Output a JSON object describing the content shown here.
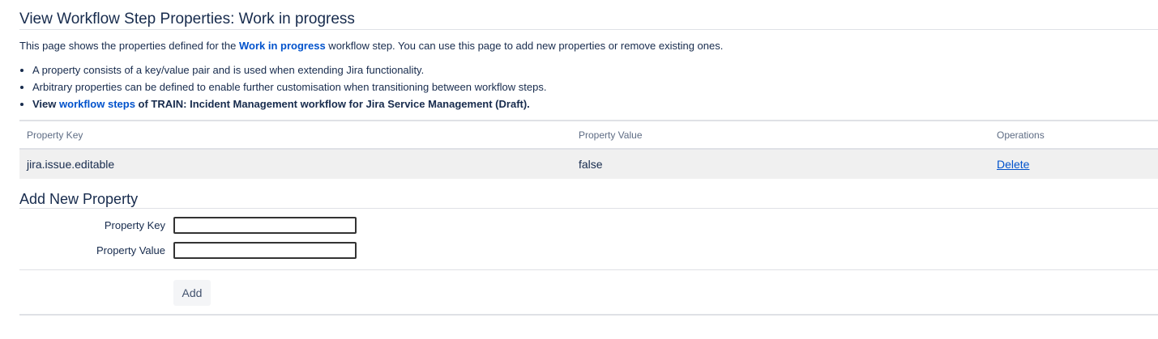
{
  "page": {
    "title": "View Workflow Step Properties: Work in progress",
    "intro_before": "This page shows the properties defined for the ",
    "intro_link": "Work in progress",
    "intro_after": " workflow step. You can use this page to add new properties or remove existing ones."
  },
  "bullets": {
    "item1": "A property consists of a key/value pair and is used when extending Jira functionality.",
    "item2": "Arbitrary properties can be defined to enable further customisation when transitioning between workflow steps.",
    "item3_before": "View ",
    "item3_link": "workflow steps",
    "item3_after": " of TRAIN: Incident Management workflow for Jira Service Management (Draft)."
  },
  "table": {
    "headers": [
      "Property Key",
      "Property Value",
      "Operations"
    ],
    "rows": [
      {
        "key": "jira.issue.editable",
        "value": "false",
        "operation": "Delete"
      }
    ]
  },
  "add_form": {
    "title": "Add New Property",
    "key_label": "Property Key",
    "value_label": "Property Value",
    "key_value": "",
    "value_value": "",
    "submit": "Add"
  },
  "colors": {
    "link": "#0052cc",
    "row_bg": "#f0f0f0",
    "border": "#dfe1e6"
  }
}
